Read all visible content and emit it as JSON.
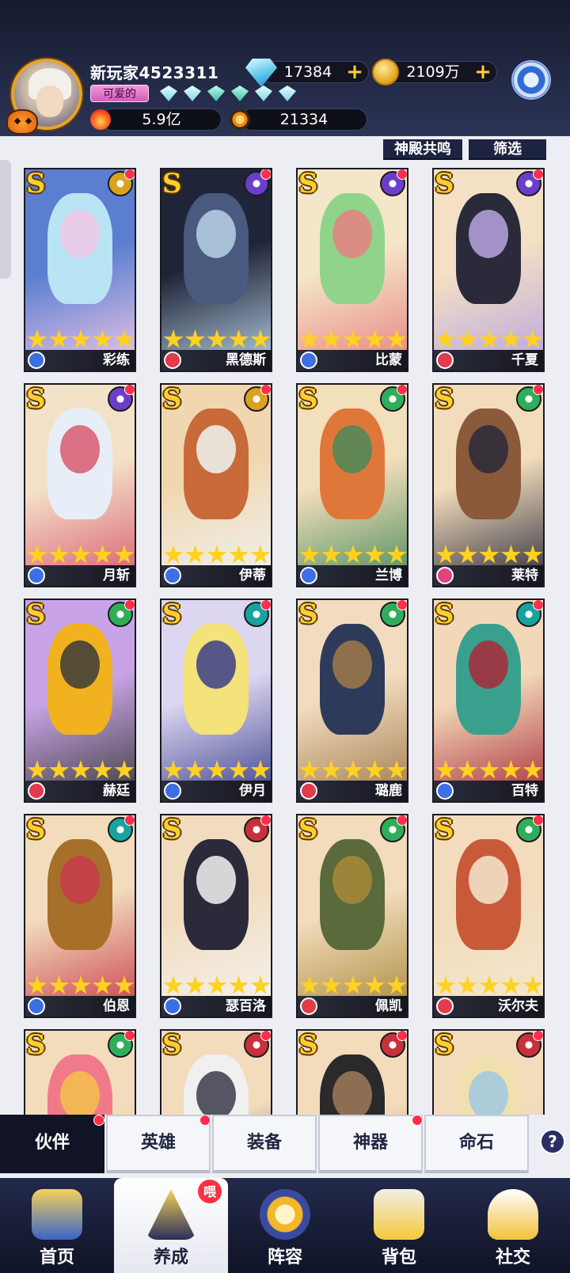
{
  "player": {
    "name": "新玩家4523311",
    "title": "可爱的",
    "diamonds": "17384",
    "gold": "2109万",
    "power": "5.9亿",
    "stardust": "21334"
  },
  "filters": {
    "resonance": "神殿共鸣",
    "filter": "筛选"
  },
  "heroes": [
    {
      "name": "彩练",
      "rank": "S",
      "faction": "neutral",
      "role": "blue",
      "art": [
        "#5b7ed0",
        "#b8e4f4",
        "#f0c8e8"
      ]
    },
    {
      "name": "黑德斯",
      "rank": "S",
      "faction": "dark",
      "role": "red",
      "art": [
        "#1f2438",
        "#4a5a7e",
        "#b9d2e6"
      ]
    },
    {
      "name": "比蒙",
      "rank": "S",
      "faction": "dark",
      "role": "blue",
      "art": [
        "#f4e6c8",
        "#8fd48a",
        "#e88080"
      ]
    },
    {
      "name": "千夏",
      "rank": "S",
      "faction": "dark",
      "role": "red",
      "art": [
        "#f4e0c4",
        "#2a2a3a",
        "#b8a4e0"
      ]
    },
    {
      "name": "月斩",
      "rank": "S",
      "faction": "dark",
      "role": "blue",
      "art": [
        "#f4e2c8",
        "#e8eef8",
        "#d85a70"
      ]
    },
    {
      "name": "伊蒂",
      "rank": "S",
      "faction": "neutral",
      "role": "blue",
      "art": [
        "#f1d7b0",
        "#c86a3a",
        "#eef4f4"
      ]
    },
    {
      "name": "兰博",
      "rank": "S",
      "faction": "nature",
      "role": "blue",
      "art": [
        "#f2dfbc",
        "#e0773a",
        "#4a8a5a"
      ]
    },
    {
      "name": "莱特",
      "rank": "S",
      "faction": "nature",
      "role": "pink",
      "art": [
        "#f2dcbc",
        "#8a5a3a",
        "#2a2a3a"
      ]
    },
    {
      "name": "赫廷",
      "rank": "S",
      "faction": "nature",
      "role": "red",
      "art": [
        "#c8a4e6",
        "#f2b21f",
        "#3a3a3a"
      ]
    },
    {
      "name": "伊月",
      "rank": "S",
      "faction": "water",
      "role": "blue",
      "art": [
        "#dcd6f0",
        "#f4e27a",
        "#3a3e8a"
      ]
    },
    {
      "name": "璐鹿",
      "rank": "S",
      "faction": "nature",
      "role": "red",
      "art": [
        "#f2dcc0",
        "#2e3a5a",
        "#a07a4a"
      ]
    },
    {
      "name": "百特",
      "rank": "S",
      "faction": "water",
      "role": "blue",
      "art": [
        "#f2d8b8",
        "#3aa08e",
        "#a82a3a"
      ]
    },
    {
      "name": "伯恩",
      "rank": "S",
      "faction": "water",
      "role": "blue",
      "art": [
        "#f2dcbc",
        "#a6702a",
        "#c83a4a"
      ]
    },
    {
      "name": "瑟百洛",
      "rank": "S",
      "faction": "fire",
      "role": "blue",
      "art": [
        "#f2dcc0",
        "#2a2a3a",
        "#f4f4f4"
      ]
    },
    {
      "name": "佩凯",
      "rank": "S",
      "faction": "nature",
      "role": "red",
      "art": [
        "#f2dcbc",
        "#5a6a3a",
        "#a8883a"
      ]
    },
    {
      "name": "沃尔夫",
      "rank": "S",
      "faction": "nature",
      "role": "red",
      "art": [
        "#f2dcbc",
        "#c85a3a",
        "#f4e8d0"
      ]
    },
    {
      "name": "",
      "rank": "S",
      "faction": "nature",
      "role": "blue",
      "art": [
        "#f2dcbc",
        "#f07a8a",
        "#f4c04a"
      ]
    },
    {
      "name": "",
      "rank": "S",
      "faction": "fire",
      "role": "blue",
      "art": [
        "#f2dcbc",
        "#f0f0f0",
        "#3a3a4a"
      ]
    },
    {
      "name": "",
      "rank": "S",
      "faction": "fire",
      "role": "blue",
      "art": [
        "#f2dcbc",
        "#2a2a2a",
        "#a07a5a"
      ]
    },
    {
      "name": "",
      "rank": "S",
      "faction": "fire",
      "role": "blue",
      "art": [
        "#f2dcbc",
        "#f0e0b0",
        "#a0c8e0"
      ]
    }
  ],
  "faction_colors": {
    "neutral": "#d9a320",
    "dark": "#6a3fc8",
    "nature": "#2fae5a",
    "water": "#17a3a0",
    "fire": "#c8303a"
  },
  "subtabs": [
    "伙伴",
    "英雄",
    "装备",
    "神器",
    "命石"
  ],
  "help_label": "?",
  "nav": [
    {
      "label": "首页",
      "icon": "temple-icon"
    },
    {
      "label": "养成",
      "icon": "star-triangle-icon",
      "badge": "喂"
    },
    {
      "label": "阵容",
      "icon": "compass-icon"
    },
    {
      "label": "背包",
      "icon": "bag-icon"
    },
    {
      "label": "社交",
      "icon": "ghost-mail-icon"
    }
  ]
}
